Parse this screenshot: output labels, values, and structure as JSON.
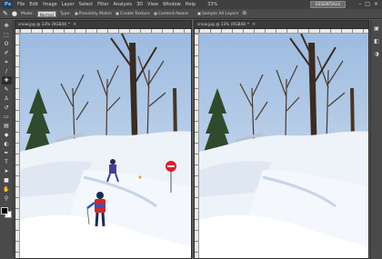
{
  "app": {
    "logo": "Ps",
    "menu": [
      "File",
      "Edit",
      "Image",
      "Layer",
      "Select",
      "Filter",
      "Analysis",
      "3D",
      "View",
      "Window",
      "Help"
    ],
    "zoom": "33%",
    "workspace_button": "ESSENTIALS",
    "window_controls": [
      "–",
      "□",
      "×"
    ]
  },
  "options": {
    "mode_label": "Mode:",
    "mode_value": "Normal",
    "type_label": "Type:",
    "type_options": [
      "Proximity Match",
      "Create Texture",
      "Content-Aware"
    ],
    "type_selected": "Content-Aware",
    "sample_all_layers": "Sample All Layers"
  },
  "tools": {
    "items": [
      "move-icon",
      "marquee-icon",
      "lasso-icon",
      "quick-select-icon",
      "crop-icon",
      "eyedropper-icon",
      "spot-healing-icon",
      "brush-icon",
      "clone-stamp-icon",
      "history-brush-icon",
      "eraser-icon",
      "gradient-icon",
      "blur-icon",
      "dodge-icon",
      "pen-icon",
      "type-icon",
      "path-select-icon",
      "shape-icon",
      "hand-icon",
      "zoom-icon"
    ],
    "selected": "spot-healing-icon"
  },
  "documents": [
    {
      "tab_label": "snow.jpg @ 33% (RGB/8) *",
      "variant": "original"
    },
    {
      "tab_label": "snow.jpg @ 33% (RGB/8) *",
      "variant": "retouched"
    }
  ],
  "colors": {
    "sky": "#a9c4e3",
    "snow": "#f2f5fb",
    "snow_shadow": "#cdd8ea",
    "tree_dark": "#3a2c22",
    "pine": "#2f4a2c",
    "jacket_red": "#d02828",
    "jacket_blue": "#3747a8",
    "sign_red": "#d9202a"
  }
}
